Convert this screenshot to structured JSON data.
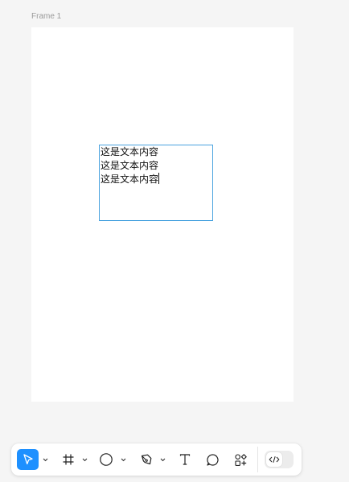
{
  "canvas": {
    "frame_label": "Frame 1"
  },
  "text_box": {
    "lines": [
      "这是文本内容",
      "这是文本内容",
      "这是文本内容"
    ]
  },
  "toolbar": {
    "tools": [
      {
        "name": "move",
        "icon": "cursor-icon",
        "active": true,
        "has_menu": true
      },
      {
        "name": "frame",
        "icon": "frame-hash-icon",
        "active": false,
        "has_menu": true
      },
      {
        "name": "shape",
        "icon": "ellipse-icon",
        "active": false,
        "has_menu": true
      },
      {
        "name": "pen",
        "icon": "pen-icon",
        "active": false,
        "has_menu": true
      },
      {
        "name": "text",
        "icon": "text-icon",
        "active": false,
        "has_menu": false
      },
      {
        "name": "comment",
        "icon": "comment-icon",
        "active": false,
        "has_menu": false
      },
      {
        "name": "resources",
        "icon": "resources-icon",
        "active": false,
        "has_menu": false
      }
    ],
    "dev_mode": {
      "icon": "code-icon",
      "enabled": false
    }
  },
  "colors": {
    "accent": "#1e90ff",
    "selection": "#4aa3df",
    "canvas_bg": "#f5f5f5",
    "frame_bg": "#ffffff"
  }
}
